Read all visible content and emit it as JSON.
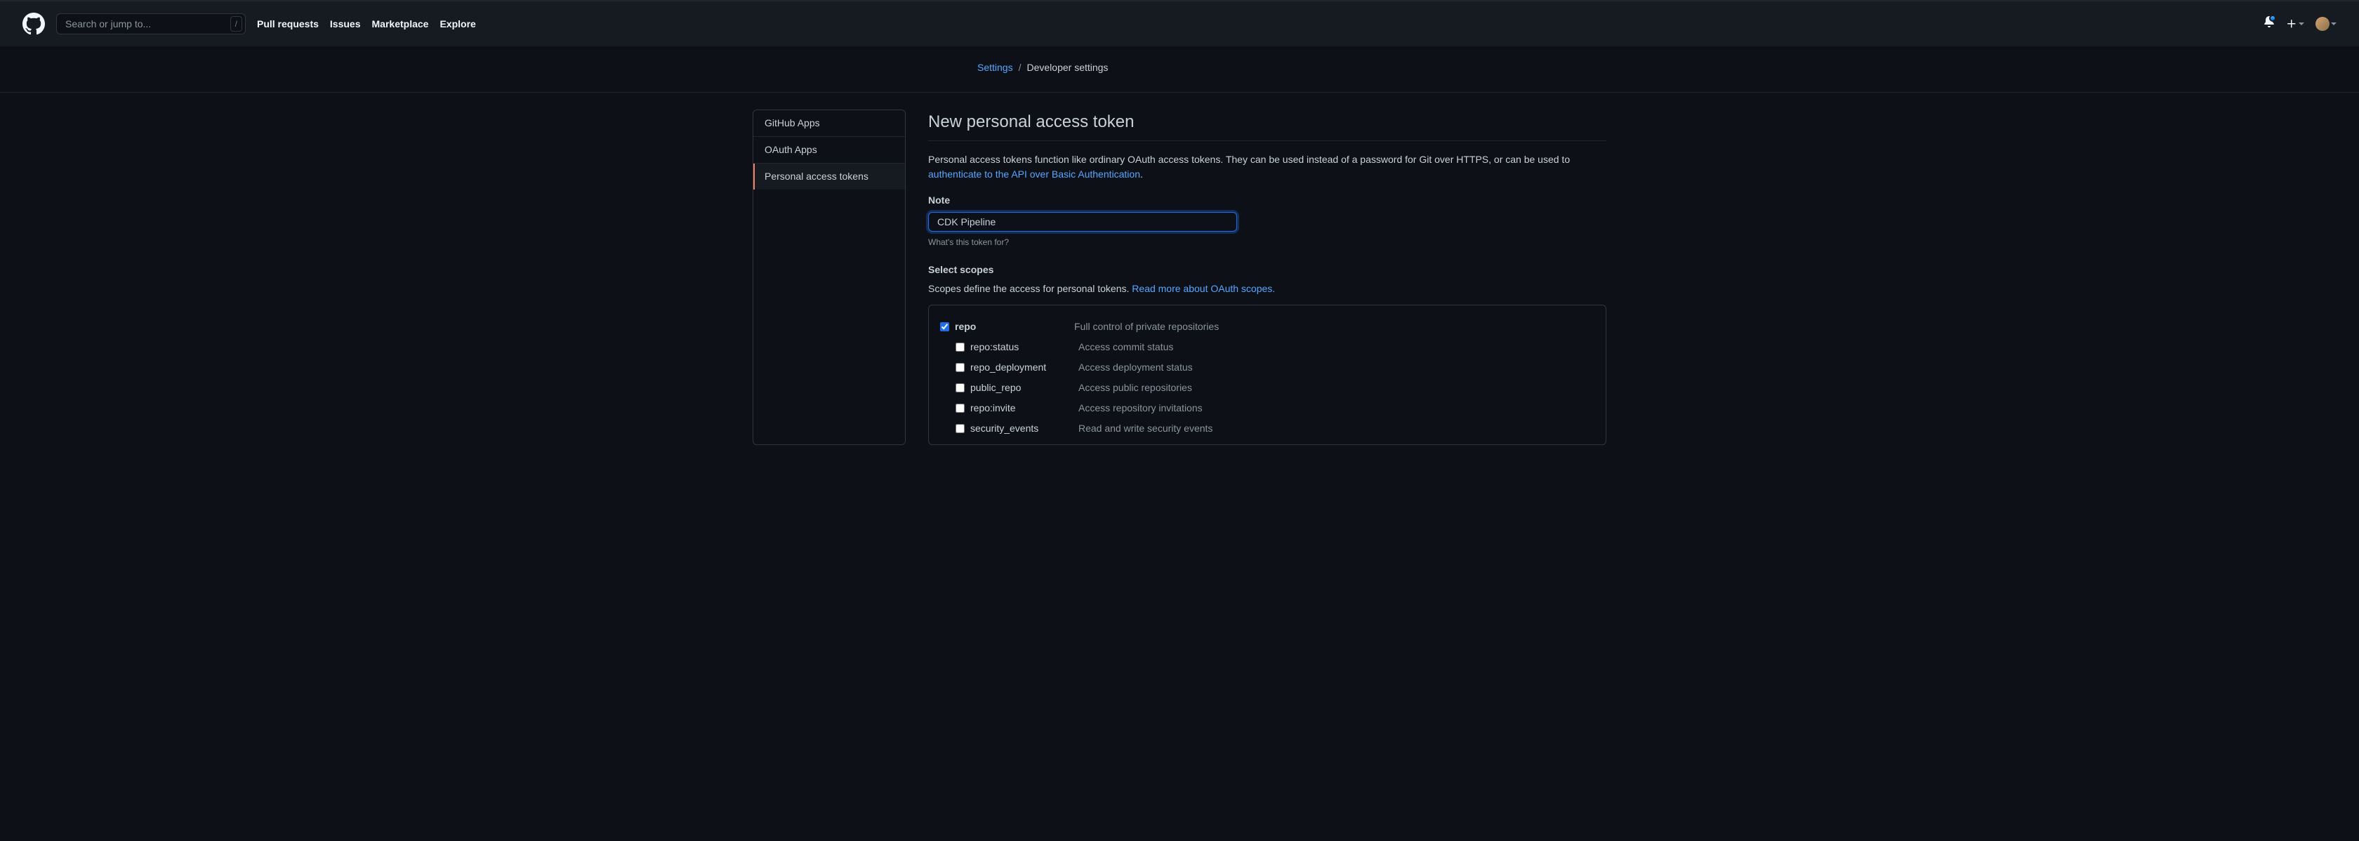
{
  "topbar": {
    "search_placeholder": "Search or jump to...",
    "slash": "/",
    "nav": {
      "pulls": "Pull requests",
      "issues": "Issues",
      "marketplace": "Marketplace",
      "explore": "Explore"
    }
  },
  "breadcrumb": {
    "settings": "Settings",
    "sep": "/",
    "current": "Developer settings"
  },
  "sidebar": {
    "items": [
      {
        "label": "GitHub Apps",
        "active": false
      },
      {
        "label": "OAuth Apps",
        "active": false
      },
      {
        "label": "Personal access tokens",
        "active": true
      }
    ]
  },
  "main": {
    "title": "New personal access token",
    "intro_prefix": "Personal access tokens function like ordinary OAuth access tokens. They can be used instead of a password for Git over HTTPS, or can be used to ",
    "intro_link": "authenticate to the API over Basic Authentication",
    "intro_suffix": ".",
    "note_label": "Note",
    "note_value": "CDK Pipeline",
    "note_hint": "What's this token for?",
    "scopes_heading": "Select scopes",
    "scopes_intro": "Scopes define the access for personal tokens. ",
    "scopes_link": "Read more about OAuth scopes.",
    "scopes": [
      {
        "name": "repo",
        "desc": "Full control of private repositories",
        "checked": true,
        "sub": false
      },
      {
        "name": "repo:status",
        "desc": "Access commit status",
        "checked": false,
        "sub": true
      },
      {
        "name": "repo_deployment",
        "desc": "Access deployment status",
        "checked": false,
        "sub": true
      },
      {
        "name": "public_repo",
        "desc": "Access public repositories",
        "checked": false,
        "sub": true
      },
      {
        "name": "repo:invite",
        "desc": "Access repository invitations",
        "checked": false,
        "sub": true
      },
      {
        "name": "security_events",
        "desc": "Read and write security events",
        "checked": false,
        "sub": true
      }
    ]
  }
}
